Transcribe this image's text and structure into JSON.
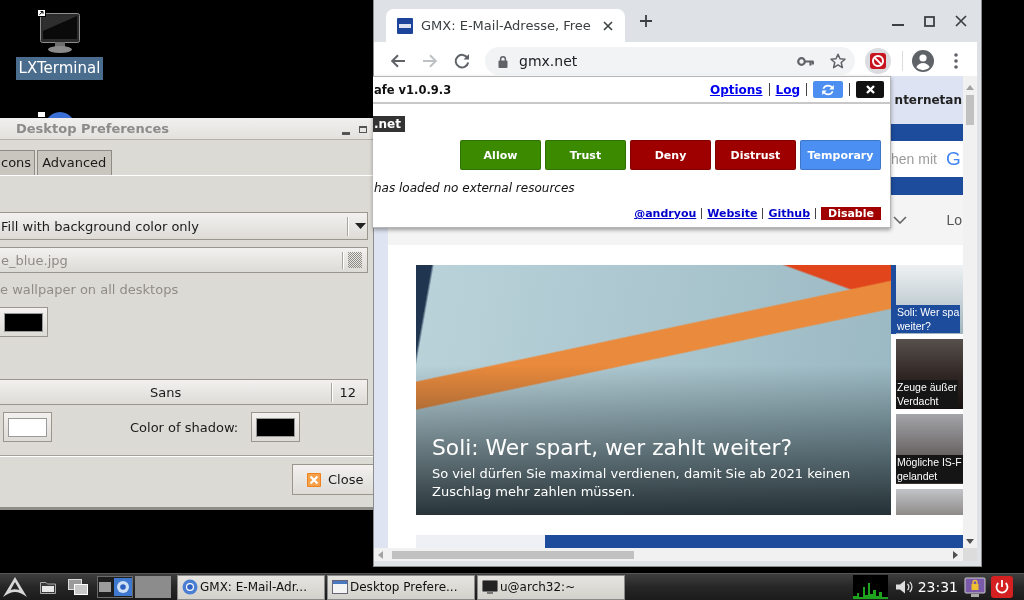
{
  "desktop": {
    "icons": [
      {
        "kind": "terminal",
        "label": "LXTerminal",
        "selected": true
      },
      {
        "kind": "shortcut",
        "selected": false
      }
    ]
  },
  "prefs_dialog": {
    "title": "Desktop Preferences",
    "active": false,
    "tabs": [
      {
        "label": "cons",
        "selected": false
      },
      {
        "label": "Advanced",
        "selected": false
      }
    ],
    "fill_mode": {
      "value": "Fill with background color only"
    },
    "wallpaper_file": {
      "value": "e_blue.jpg",
      "disabled": true
    },
    "all_desktops": {
      "label": "e wallpaper on all desktops",
      "disabled": true
    },
    "background_color": {
      "color": "#000000"
    },
    "font": {
      "family": "Sans",
      "size": "12"
    },
    "text_color": {
      "color": "#ffffff"
    },
    "shadow_color": {
      "label": "Color of shadow:",
      "color": "#000000"
    },
    "close_button": "Close"
  },
  "browser": {
    "tab_title": "GMX: E-Mail-Adresse, Free",
    "nav": [
      {
        "kind": "back",
        "disabled": false
      },
      {
        "kind": "forward",
        "disabled": true
      },
      {
        "kind": "reload",
        "disabled": false
      }
    ],
    "address": "gmx.net",
    "popup": {
      "title": "afe v1.0.9.3",
      "links": [
        "Options",
        "Log"
      ],
      "domain": ".net",
      "buttons": [
        {
          "label": "Allow",
          "color": "#3c8a00"
        },
        {
          "label": "Trust",
          "color": "#3c8a00"
        },
        {
          "label": "Deny",
          "color": "#9e0000"
        },
        {
          "label": "Distrust",
          "color": "#9e0000"
        },
        {
          "label": "Temporary",
          "color": "#4c8ff2"
        }
      ],
      "status": "has loaded no external resources",
      "footer_links": [
        "@andryou",
        "Website",
        "Github"
      ],
      "disable_button": "Disable"
    },
    "page": {
      "header_text": "nternetan",
      "search": {
        "placeholder": "hen mit",
        "logo_letter": "G"
      },
      "nav_text": "Lo",
      "hero": {
        "headline": "Soli: Wer spart, wer zahlt weiter?",
        "teaser": "So viel dürfen Sie maximal verdienen, damit Sie ab 2021 keinen Zuschlag mehr zahlen müssen."
      },
      "side_teasers": [
        {
          "caption": "Soli: Wer spa\nweiter?",
          "selected": true
        },
        {
          "caption": "Zeuge äußer\nVerdacht",
          "selected": false
        },
        {
          "caption": "Mögliche IS-F\ngelandet",
          "selected": false
        },
        {
          "selected": false
        }
      ]
    }
  },
  "taskbar": {
    "pager": [
      {
        "selected": true
      },
      {
        "selected": false
      }
    ],
    "tasks": [
      {
        "kind": "browser",
        "label": "GMX: E-Mail-Adr..."
      },
      {
        "kind": "window",
        "label": "Desktop Prefere..."
      },
      {
        "kind": "terminal",
        "label": "u@arch32:~"
      }
    ],
    "clock": "23:31"
  }
}
